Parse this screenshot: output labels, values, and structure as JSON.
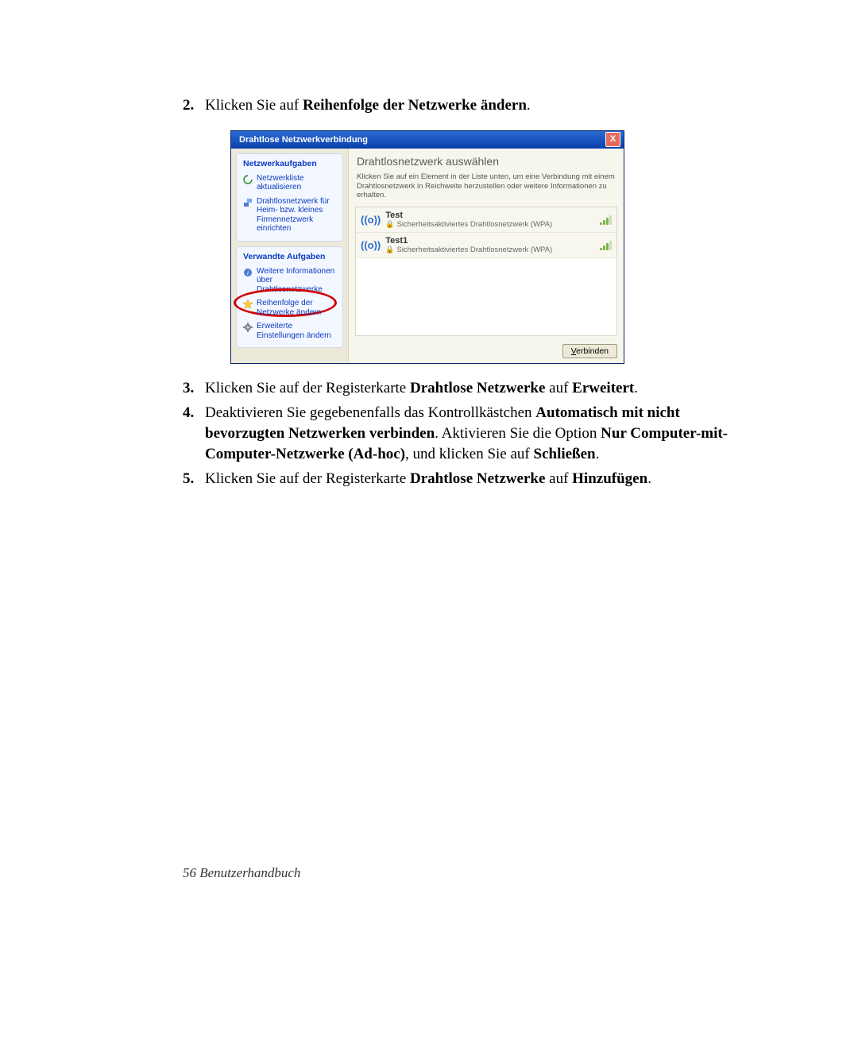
{
  "steps": {
    "s2": {
      "num": "2.",
      "pre": "Klicken Sie auf ",
      "bold": "Reihenfolge der Netzwerke ändern",
      "post": "."
    },
    "s3": {
      "num": "3.",
      "t1": "Klicken Sie auf der Registerkarte ",
      "b1": "Drahtlose Netzwerke",
      "t2": " auf ",
      "b2": "Erweitert",
      "t3": "."
    },
    "s4": {
      "num": "4.",
      "t1": "Deaktivieren Sie gegebenenfalls das Kontrollkästchen ",
      "b1": "Automatisch mit nicht bevorzugten Netzwerken verbinden",
      "t2": ". Aktivieren Sie die Option ",
      "b2": "Nur Computer-mit-Computer-Netzwerke (Ad-hoc)",
      "t3": ", und klicken Sie auf ",
      "b3": "Schließen",
      "t4": "."
    },
    "s5": {
      "num": "5.",
      "t1": "Klicken Sie auf der Registerkarte ",
      "b1": "Drahtlose Netzwerke",
      "t2": " auf ",
      "b2": "Hinzufügen",
      "t3": "."
    }
  },
  "dialog": {
    "title": "Drahtlose Netzwerkverbindung",
    "close": "X",
    "side1_h": "Netzwerkaufgaben",
    "side1_a": "Netzwerkliste aktualisieren",
    "side1_b": "Drahtlosnetzwerk für Heim- bzw. kleines Firmennetzwerk einrichten",
    "side2_h": "Verwandte Aufgaben",
    "side2_a": "Weitere Informationen über Drahtlosnetzwerke",
    "side2_b": "Reihenfolge der Netzwerke ändern",
    "side2_c": "Erweiterte Einstellungen ändern",
    "main_title": "Drahtlosnetzwerk auswählen",
    "main_sub": "Klicken Sie auf ein Element in der Liste unten, um eine Verbindung mit einem Drahtlosnetzwerk in Reichweite herzustellen oder weitere Informationen zu erhalten.",
    "net1_name": "Test",
    "net1_sec": "Sicherheitsaktiviertes Drahtlosnetzwerk (WPA)",
    "net2_name": "Test1",
    "net2_sec": "Sicherheitsaktiviertes Drahtlosnetzwerk (WPA)",
    "connect_u": "V",
    "connect_rest": "erbinden"
  },
  "footer": "56  Benutzerhandbuch"
}
